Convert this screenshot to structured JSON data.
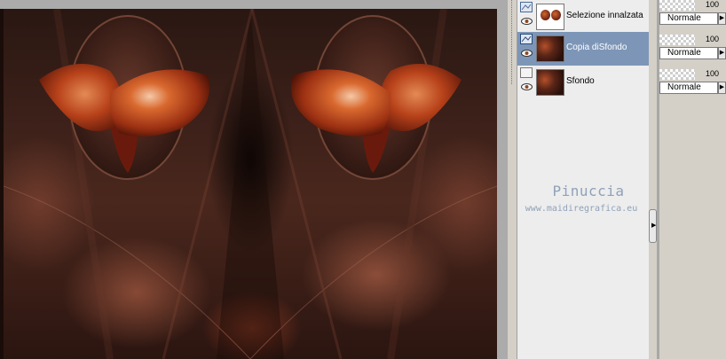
{
  "layers": [
    {
      "name": "Selezione innalzata",
      "selected": false,
      "thumbnail": "selection-thumb"
    },
    {
      "name": "Copia diSfondo",
      "selected": true,
      "thumbnail": "image-thumb"
    },
    {
      "name": "Sfondo",
      "selected": false,
      "thumbnail": "image-thumb"
    }
  ],
  "properties": [
    {
      "opacity": "100",
      "blend_mode": "Normale"
    },
    {
      "opacity": "100",
      "blend_mode": "Normale"
    },
    {
      "opacity": "100",
      "blend_mode": "Normale"
    }
  ],
  "watermark": {
    "title": "Pinuccia",
    "url": "www.maidiregrafica.eu"
  },
  "colors": {
    "selected_layer": "#7d96b8",
    "watermark": "#8fa1b8"
  }
}
